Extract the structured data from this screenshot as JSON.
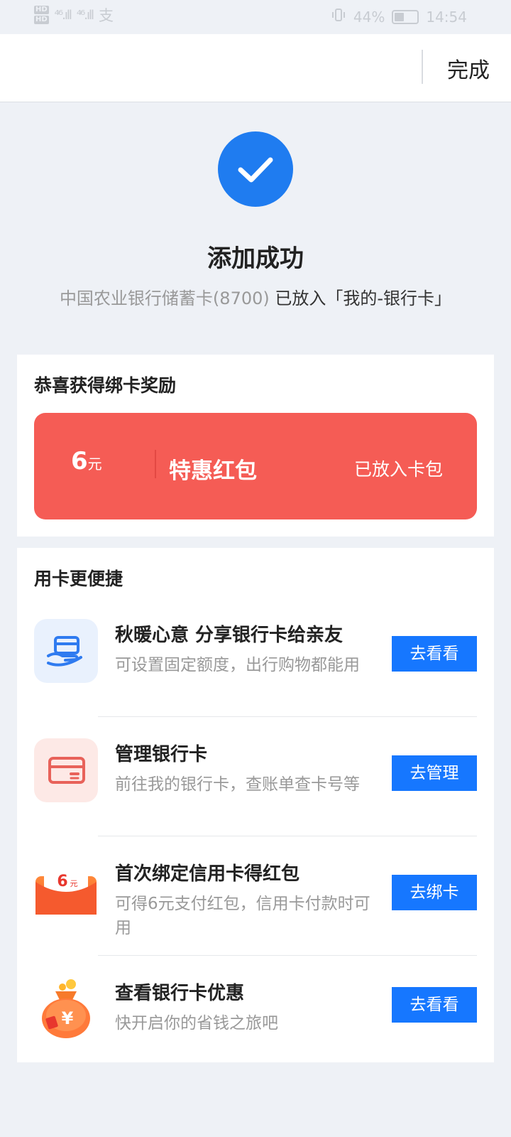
{
  "status_bar": {
    "network_badge_1": "HD",
    "network_badge_2": "HD",
    "signal_1": "⁴⁶.ıll",
    "signal_2": "⁴⁶.ıll",
    "extra": "支",
    "battery_percent": "44%",
    "battery_level": 0.44,
    "time": "14:54"
  },
  "nav": {
    "done_label": "完成"
  },
  "success": {
    "title": "添加成功",
    "card_name": "中国农业银行储蓄卡(8700)",
    "placed_text": "已放入「我的-银行卡」"
  },
  "reward": {
    "section_title": "恭喜获得绑卡奖励",
    "amount": "6",
    "unit": "元",
    "name": "特惠红包",
    "status": "已放入卡包"
  },
  "features": {
    "section_title": "用卡更便捷",
    "items": [
      {
        "icon": "hand-card-icon",
        "title": "秋暖心意 分享银行卡给亲友",
        "desc": "可设置固定额度，出行购物都能用",
        "button": "去看看"
      },
      {
        "icon": "bank-card-icon",
        "title": "管理银行卡",
        "desc": "前往我的银行卡，查账单查卡号等",
        "button": "去管理"
      },
      {
        "icon": "red-packet-icon",
        "title": "首次绑定信用卡得红包",
        "desc": "可得6元支付红包，信用卡付款时可用",
        "button": "去绑卡",
        "icon_text": "6",
        "icon_unit": "元"
      },
      {
        "icon": "money-bag-icon",
        "title": "查看银行卡优惠",
        "desc": "快开启你的省钱之旅吧",
        "button": "去看看",
        "icon_text": "¥"
      }
    ]
  },
  "colors": {
    "primary": "#1677ff",
    "check": "#1f7cf0",
    "coupon": "#f55c55",
    "background": "#eef1f6"
  }
}
